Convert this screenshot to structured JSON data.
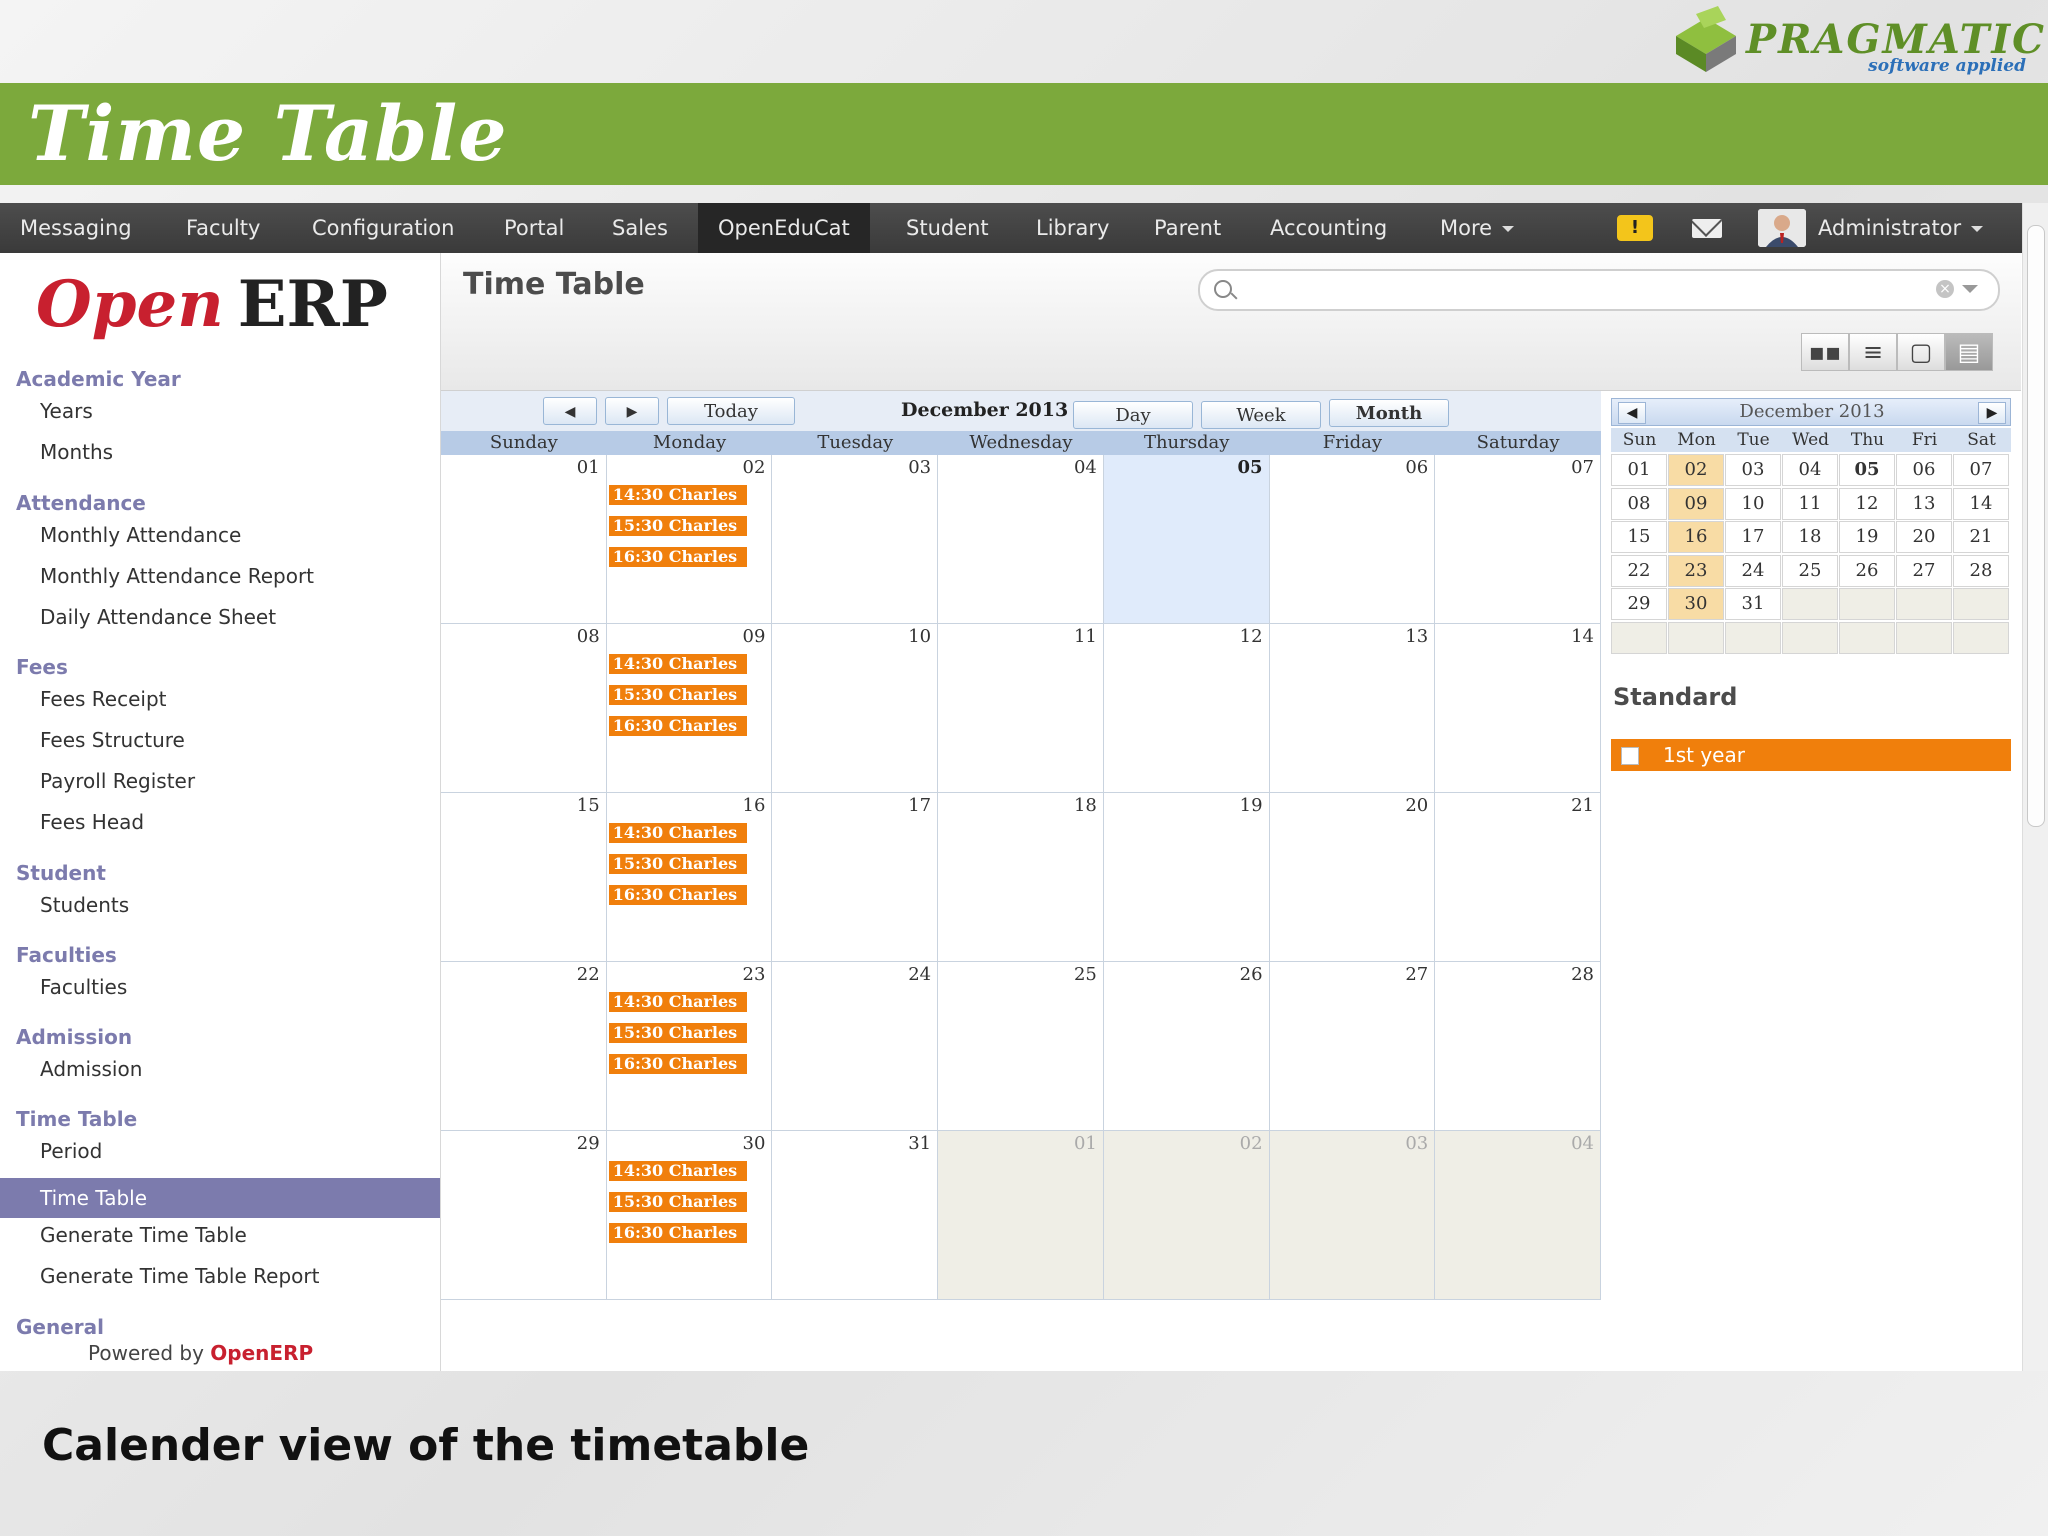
{
  "slide": {
    "title": "Time Table",
    "caption": "Calender view of the timetable",
    "brand_name": "PRAGMATIC",
    "brand_tagline": "software applied",
    "brand_color": "#7ca93c"
  },
  "topnav": {
    "items": [
      "Messaging",
      "Faculty",
      "Configuration",
      "Portal",
      "Sales",
      "OpenEduCat",
      "Student",
      "Library",
      "Parent",
      "Accounting",
      "More"
    ],
    "active": "OpenEduCat",
    "alert_icon": "alert-icon",
    "mail_icon": "mail-icon",
    "user": "Administrator"
  },
  "sidebar": {
    "logo_open": "Open",
    "logo_erp": "ERP",
    "sections": [
      {
        "title": "Academic Year",
        "items": [
          "Years",
          "Months"
        ]
      },
      {
        "title": "Attendance",
        "items": [
          "Monthly Attendance",
          "Monthly Attendance Report",
          "Daily Attendance Sheet"
        ]
      },
      {
        "title": "Fees",
        "items": [
          "Fees Receipt",
          "Fees Structure",
          "Payroll Register",
          "Fees Head"
        ]
      },
      {
        "title": "Student",
        "items": [
          "Students"
        ]
      },
      {
        "title": "Faculties",
        "items": [
          "Faculties"
        ]
      },
      {
        "title": "Admission",
        "items": [
          "Admission"
        ]
      },
      {
        "title": "Time Table",
        "items": [
          "Period",
          "Time Table",
          "Generate Time Table",
          "Generate Time Table Report"
        ]
      },
      {
        "title": "General",
        "items": []
      }
    ],
    "selected_item": "Time Table",
    "powered_by": "Powered by",
    "powered_brand": "OpenERP"
  },
  "main": {
    "title": "Time Table",
    "search_placeholder": "",
    "view_icons": [
      "kanban-icon",
      "list-icon",
      "form-icon",
      "calendar-icon"
    ],
    "active_view": "calendar-icon"
  },
  "calendar": {
    "toolbar": {
      "prev": "◀",
      "next": "▶",
      "today": "Today",
      "month_label": "December 2013",
      "views": [
        "Day",
        "Week",
        "Month"
      ],
      "active_view": "Month"
    },
    "weekdays": [
      "Sunday",
      "Monday",
      "Tuesday",
      "Wednesday",
      "Thursday",
      "Friday",
      "Saturday"
    ],
    "weeks": [
      [
        "01",
        "02",
        "03",
        "04",
        "05",
        "06",
        "07"
      ],
      [
        "08",
        "09",
        "10",
        "11",
        "12",
        "13",
        "14"
      ],
      [
        "15",
        "16",
        "17",
        "18",
        "19",
        "20",
        "21"
      ],
      [
        "22",
        "23",
        "24",
        "25",
        "26",
        "27",
        "28"
      ],
      [
        "29",
        "30",
        "31",
        "01",
        "02",
        "03",
        "04"
      ]
    ],
    "today": "05",
    "other_month_cells": [
      [
        4,
        3
      ],
      [
        4,
        4
      ],
      [
        4,
        5
      ],
      [
        4,
        6
      ]
    ],
    "event_day_column": 1,
    "events": [
      "14:30 Charles",
      "15:30 Charles",
      "16:30 Charles"
    ],
    "event_color": "#f07f0c"
  },
  "mini_calendar": {
    "title": "December 2013",
    "weekdays": [
      "Sun",
      "Mon",
      "Tue",
      "Wed",
      "Thu",
      "Fri",
      "Sat"
    ],
    "weeks": [
      [
        "01",
        "02",
        "03",
        "04",
        "05",
        "06",
        "07"
      ],
      [
        "08",
        "09",
        "10",
        "11",
        "12",
        "13",
        "14"
      ],
      [
        "15",
        "16",
        "17",
        "18",
        "19",
        "20",
        "21"
      ],
      [
        "22",
        "23",
        "24",
        "25",
        "26",
        "27",
        "28"
      ],
      [
        "29",
        "30",
        "31",
        "",
        "",
        "",
        ""
      ],
      [
        "",
        "",
        "",
        "",
        "",
        "",
        ""
      ]
    ],
    "highlight_column": 1,
    "today": "05"
  },
  "standard": {
    "title": "Standard",
    "items": [
      "1st year"
    ]
  }
}
